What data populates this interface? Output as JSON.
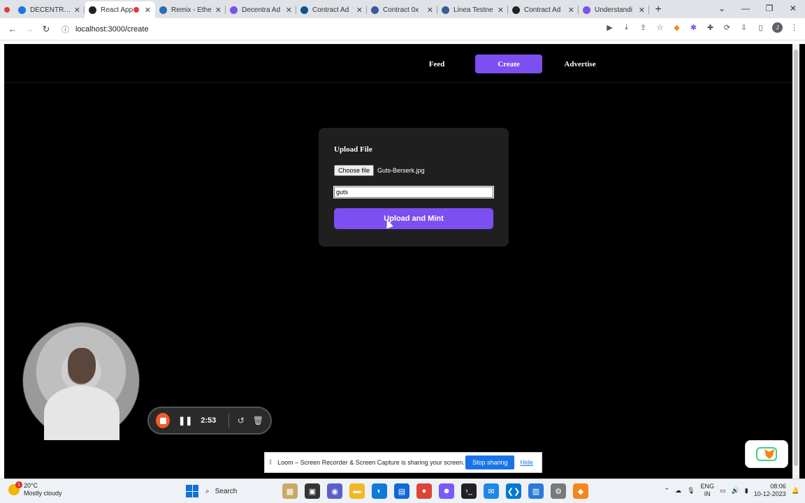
{
  "browser": {
    "tabs": [
      {
        "label": "DECENTRAD",
        "color": "#1a73e8",
        "active": false,
        "recording": false
      },
      {
        "label": "React App",
        "color": "#222222",
        "active": true,
        "recording": true
      },
      {
        "label": "Remix - Ethe",
        "color": "#2b6cb0",
        "active": false,
        "recording": false
      },
      {
        "label": "Decentra Ad",
        "color": "#7b4ff0",
        "active": false,
        "recording": false
      },
      {
        "label": "Contract Ad",
        "color": "#0b5394",
        "active": false,
        "recording": false
      },
      {
        "label": "Contract 0x",
        "color": "#3c5a99",
        "active": false,
        "recording": false
      },
      {
        "label": "Linea Testne",
        "color": "#3c5a99",
        "active": false,
        "recording": false
      },
      {
        "label": "Contract Ad",
        "color": "#222222",
        "active": false,
        "recording": false
      },
      {
        "label": "Understandi",
        "color": "#7b4ff0",
        "active": false,
        "recording": false
      }
    ],
    "new_tab": "+",
    "url": "localhost:3000/create"
  },
  "app": {
    "nav": {
      "feed": "Feed",
      "create": "Create",
      "advertise": "Advertise"
    },
    "upload": {
      "heading": "Upload File",
      "choose_file": "Choose file",
      "file_name": "Guts-Berserk.jpg",
      "name_value": "guts",
      "submit": "Upload and Mint"
    }
  },
  "loom": {
    "timer": "2:53",
    "share_text": "Loom – Screen Recorder & Screen Capture is sharing your screen.",
    "stop_sharing": "Stop sharing",
    "hide": "Hide"
  },
  "taskbar": {
    "temperature": "20°C",
    "weather": "Mostly cloudy",
    "weather_badge": "1",
    "search": "Search",
    "lang_top": "ENG",
    "lang_bottom": "IN",
    "time": "08:06",
    "date": "10-12-2023"
  },
  "colors": {
    "accent": "#7b4ff0",
    "loom_stop": "#f25c2b"
  }
}
